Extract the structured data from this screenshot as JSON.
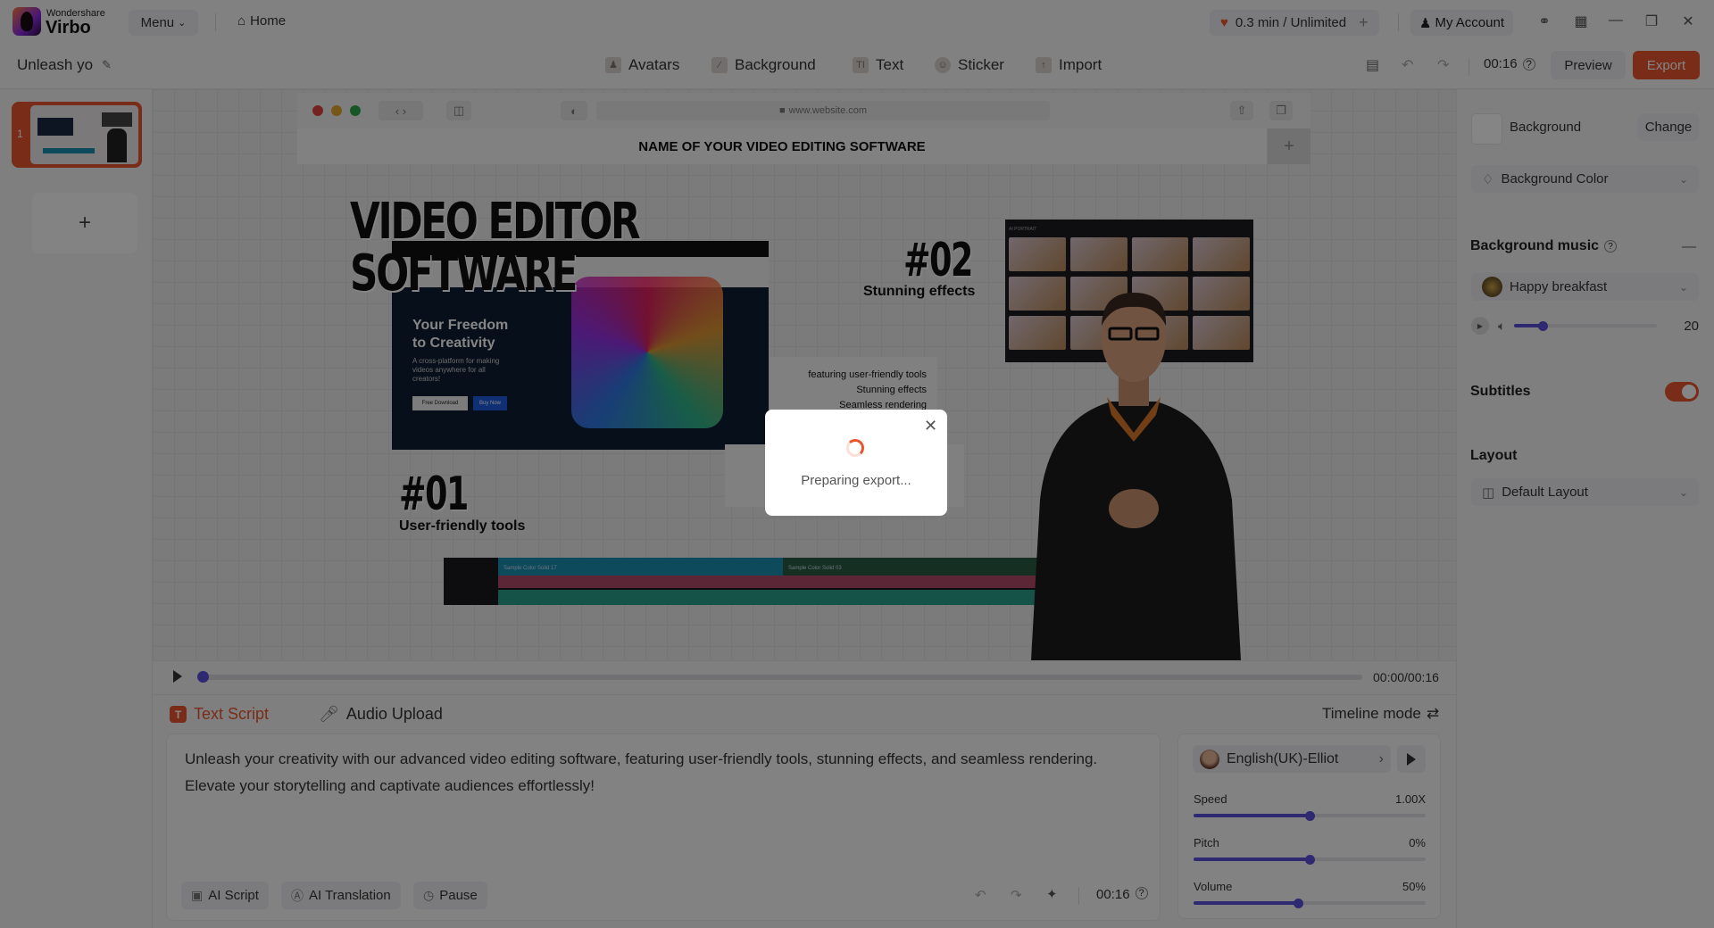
{
  "app": {
    "brand_small": "Wondershare",
    "brand_big": "Virbo",
    "menu_label": "Menu",
    "home_label": "Home",
    "quota": "0.3 min / Unlimited",
    "account_label": "My Account"
  },
  "toolbar": {
    "project_title": "Unleash yo",
    "tools": [
      {
        "label": "Avatars",
        "icon": "avatar-icon"
      },
      {
        "label": "Background",
        "icon": "background-icon"
      },
      {
        "label": "Text",
        "icon": "text-icon"
      },
      {
        "label": "Sticker",
        "icon": "sticker-icon"
      },
      {
        "label": "Import",
        "icon": "import-icon"
      }
    ],
    "duration": "00:16",
    "preview_label": "Preview",
    "export_label": "Export"
  },
  "slides": {
    "items": [
      {
        "number": "1"
      }
    ],
    "add_label": "+"
  },
  "canvas": {
    "url": "www.website.com",
    "site_title": "NAME OF YOUR VIDEO EDITING SOFTWARE",
    "headline_1": "VIDEO EDITOR",
    "headline_2": "SOFTWARE",
    "web_heading_1": "Your Freedom",
    "web_heading_2": "to Creativity",
    "web_desc": "A cross-platform for making videos anywhere for all creators!",
    "web_btn_download": "Free Download",
    "web_btn_buy": "Buy Now",
    "num1": "#01",
    "num1_sub": "User-friendly tools",
    "num2": "#02",
    "num2_sub": "Stunning effects",
    "features": [
      "featuring user-friendly tools",
      "Stunning effects",
      "Seamless rendering"
    ],
    "effects_header": "AI PORTRAIT",
    "timeline_clip_1": "Sample Color Solid 17",
    "timeline_clip_2": "Sample Color Solid 03"
  },
  "player": {
    "time": "00:00/00:16",
    "progress_fraction": 0.0
  },
  "script": {
    "tabs": [
      {
        "label": "Text Script",
        "active": true
      },
      {
        "label": "Audio Upload",
        "active": false
      }
    ],
    "timeline_mode_label": "Timeline mode",
    "text": "Unleash your creativity with our advanced video editing software, featuring user-friendly tools, stunning effects, and seamless rendering. Elevate your storytelling and captivate audiences effortlessly!",
    "buttons": [
      {
        "label": "AI Script"
      },
      {
        "label": "AI Translation"
      },
      {
        "label": "Pause"
      }
    ],
    "duration": "00:16"
  },
  "voice": {
    "name": "English(UK)-Elliot",
    "sliders": [
      {
        "label": "Speed",
        "value": "1.00X",
        "fraction": 0.5
      },
      {
        "label": "Pitch",
        "value": "0%",
        "fraction": 0.5
      },
      {
        "label": "Volume",
        "value": "50%",
        "fraction": 0.45
      }
    ]
  },
  "right_panel": {
    "background_label": "Background",
    "change_label": "Change",
    "background_color_label": "Background Color",
    "music_heading": "Background music",
    "music_track": "Happy breakfast",
    "music_volume": "20",
    "music_volume_fraction": 0.2,
    "subtitles_label": "Subtitles",
    "subtitles_on": true,
    "layout_heading": "Layout",
    "layout_value": "Default Layout"
  },
  "dialog": {
    "message": "Preparing export..."
  },
  "colors": {
    "accent": "#e8552d",
    "slider": "#5a50d8"
  }
}
